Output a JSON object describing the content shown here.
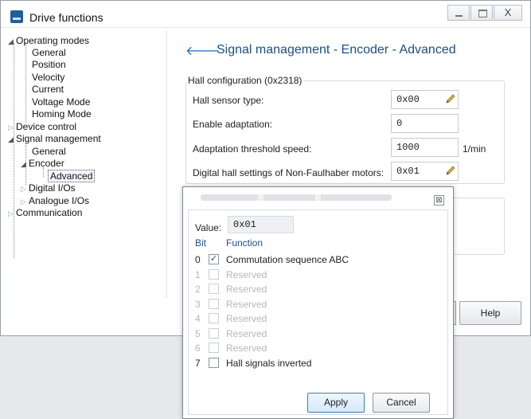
{
  "window": {
    "title": "Drive functions",
    "close_glyph": "X"
  },
  "tree": {
    "items": [
      {
        "label": "Operating modes",
        "toggle": "◢"
      },
      {
        "label": "General"
      },
      {
        "label": "Position"
      },
      {
        "label": "Velocity"
      },
      {
        "label": "Current"
      },
      {
        "label": "Voltage Mode"
      },
      {
        "label": "Homing Mode"
      },
      {
        "label": "Device control",
        "toggle": "▷"
      },
      {
        "label": "Signal management",
        "toggle": "◢"
      },
      {
        "label": "General"
      },
      {
        "label": "Encoder",
        "toggle": "◢"
      },
      {
        "label": "Advanced"
      },
      {
        "label": "Digital I/Os",
        "toggle": "▷"
      },
      {
        "label": "Analogue I/Os",
        "toggle": "▷"
      },
      {
        "label": "Communication",
        "toggle": "▷"
      }
    ]
  },
  "panel": {
    "back_arrow": "🡐",
    "title": "Signal management - Encoder - Advanced",
    "group_legend": "Hall configuration (0x2318)",
    "rows": [
      {
        "label": "Hall sensor type:",
        "value": "0x00"
      },
      {
        "label": "Enable adaptation:",
        "value": "0"
      },
      {
        "label": "Adaptation threshold speed:",
        "value": "1000",
        "unit": "1/min"
      },
      {
        "label": "Digital hall settings of Non-Faulhaber motors:",
        "value": "0x01"
      }
    ],
    "help_button": "Help"
  },
  "dialog": {
    "value_label": "Value:",
    "value": "0x01",
    "col_bit": "Bit",
    "col_function": "Function",
    "bits": [
      {
        "bit": "0",
        "label": "Commutation sequence ABC",
        "checked": true,
        "enabled": true
      },
      {
        "bit": "1",
        "label": "Reserved",
        "checked": false,
        "enabled": false
      },
      {
        "bit": "2",
        "label": "Reserved",
        "checked": false,
        "enabled": false
      },
      {
        "bit": "3",
        "label": "Reserved",
        "checked": false,
        "enabled": false
      },
      {
        "bit": "4",
        "label": "Reserved",
        "checked": false,
        "enabled": false
      },
      {
        "bit": "5",
        "label": "Reserved",
        "checked": false,
        "enabled": false
      },
      {
        "bit": "6",
        "label": "Reserved",
        "checked": false,
        "enabled": false
      },
      {
        "bit": "7",
        "label": "Hall signals inverted",
        "checked": false,
        "enabled": true
      }
    ],
    "apply_label": "Apply",
    "cancel_label": "Cancel",
    "close_glyph": "⊠",
    "check_glyph": "✓"
  },
  "colors": {
    "accent": "#1a4f86",
    "disabled_text": "#b2b7be"
  }
}
